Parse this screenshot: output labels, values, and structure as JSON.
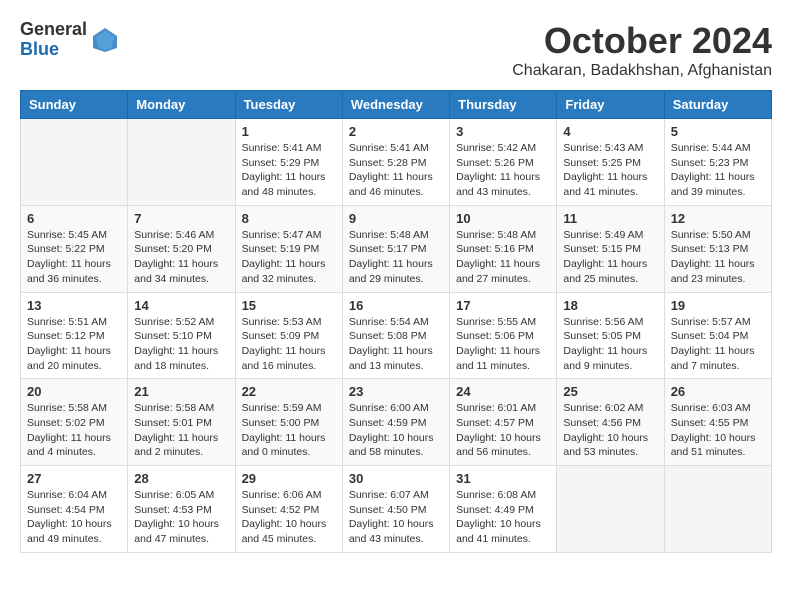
{
  "logo": {
    "general": "General",
    "blue": "Blue"
  },
  "title": "October 2024",
  "location": "Chakaran, Badakhshan, Afghanistan",
  "days_header": [
    "Sunday",
    "Monday",
    "Tuesday",
    "Wednesday",
    "Thursday",
    "Friday",
    "Saturday"
  ],
  "weeks": [
    [
      {
        "day": "",
        "sunrise": "",
        "sunset": "",
        "daylight": ""
      },
      {
        "day": "",
        "sunrise": "",
        "sunset": "",
        "daylight": ""
      },
      {
        "day": "1",
        "sunrise": "Sunrise: 5:41 AM",
        "sunset": "Sunset: 5:29 PM",
        "daylight": "Daylight: 11 hours and 48 minutes."
      },
      {
        "day": "2",
        "sunrise": "Sunrise: 5:41 AM",
        "sunset": "Sunset: 5:28 PM",
        "daylight": "Daylight: 11 hours and 46 minutes."
      },
      {
        "day": "3",
        "sunrise": "Sunrise: 5:42 AM",
        "sunset": "Sunset: 5:26 PM",
        "daylight": "Daylight: 11 hours and 43 minutes."
      },
      {
        "day": "4",
        "sunrise": "Sunrise: 5:43 AM",
        "sunset": "Sunset: 5:25 PM",
        "daylight": "Daylight: 11 hours and 41 minutes."
      },
      {
        "day": "5",
        "sunrise": "Sunrise: 5:44 AM",
        "sunset": "Sunset: 5:23 PM",
        "daylight": "Daylight: 11 hours and 39 minutes."
      }
    ],
    [
      {
        "day": "6",
        "sunrise": "Sunrise: 5:45 AM",
        "sunset": "Sunset: 5:22 PM",
        "daylight": "Daylight: 11 hours and 36 minutes."
      },
      {
        "day": "7",
        "sunrise": "Sunrise: 5:46 AM",
        "sunset": "Sunset: 5:20 PM",
        "daylight": "Daylight: 11 hours and 34 minutes."
      },
      {
        "day": "8",
        "sunrise": "Sunrise: 5:47 AM",
        "sunset": "Sunset: 5:19 PM",
        "daylight": "Daylight: 11 hours and 32 minutes."
      },
      {
        "day": "9",
        "sunrise": "Sunrise: 5:48 AM",
        "sunset": "Sunset: 5:17 PM",
        "daylight": "Daylight: 11 hours and 29 minutes."
      },
      {
        "day": "10",
        "sunrise": "Sunrise: 5:48 AM",
        "sunset": "Sunset: 5:16 PM",
        "daylight": "Daylight: 11 hours and 27 minutes."
      },
      {
        "day": "11",
        "sunrise": "Sunrise: 5:49 AM",
        "sunset": "Sunset: 5:15 PM",
        "daylight": "Daylight: 11 hours and 25 minutes."
      },
      {
        "day": "12",
        "sunrise": "Sunrise: 5:50 AM",
        "sunset": "Sunset: 5:13 PM",
        "daylight": "Daylight: 11 hours and 23 minutes."
      }
    ],
    [
      {
        "day": "13",
        "sunrise": "Sunrise: 5:51 AM",
        "sunset": "Sunset: 5:12 PM",
        "daylight": "Daylight: 11 hours and 20 minutes."
      },
      {
        "day": "14",
        "sunrise": "Sunrise: 5:52 AM",
        "sunset": "Sunset: 5:10 PM",
        "daylight": "Daylight: 11 hours and 18 minutes."
      },
      {
        "day": "15",
        "sunrise": "Sunrise: 5:53 AM",
        "sunset": "Sunset: 5:09 PM",
        "daylight": "Daylight: 11 hours and 16 minutes."
      },
      {
        "day": "16",
        "sunrise": "Sunrise: 5:54 AM",
        "sunset": "Sunset: 5:08 PM",
        "daylight": "Daylight: 11 hours and 13 minutes."
      },
      {
        "day": "17",
        "sunrise": "Sunrise: 5:55 AM",
        "sunset": "Sunset: 5:06 PM",
        "daylight": "Daylight: 11 hours and 11 minutes."
      },
      {
        "day": "18",
        "sunrise": "Sunrise: 5:56 AM",
        "sunset": "Sunset: 5:05 PM",
        "daylight": "Daylight: 11 hours and 9 minutes."
      },
      {
        "day": "19",
        "sunrise": "Sunrise: 5:57 AM",
        "sunset": "Sunset: 5:04 PM",
        "daylight": "Daylight: 11 hours and 7 minutes."
      }
    ],
    [
      {
        "day": "20",
        "sunrise": "Sunrise: 5:58 AM",
        "sunset": "Sunset: 5:02 PM",
        "daylight": "Daylight: 11 hours and 4 minutes."
      },
      {
        "day": "21",
        "sunrise": "Sunrise: 5:58 AM",
        "sunset": "Sunset: 5:01 PM",
        "daylight": "Daylight: 11 hours and 2 minutes."
      },
      {
        "day": "22",
        "sunrise": "Sunrise: 5:59 AM",
        "sunset": "Sunset: 5:00 PM",
        "daylight": "Daylight: 11 hours and 0 minutes."
      },
      {
        "day": "23",
        "sunrise": "Sunrise: 6:00 AM",
        "sunset": "Sunset: 4:59 PM",
        "daylight": "Daylight: 10 hours and 58 minutes."
      },
      {
        "day": "24",
        "sunrise": "Sunrise: 6:01 AM",
        "sunset": "Sunset: 4:57 PM",
        "daylight": "Daylight: 10 hours and 56 minutes."
      },
      {
        "day": "25",
        "sunrise": "Sunrise: 6:02 AM",
        "sunset": "Sunset: 4:56 PM",
        "daylight": "Daylight: 10 hours and 53 minutes."
      },
      {
        "day": "26",
        "sunrise": "Sunrise: 6:03 AM",
        "sunset": "Sunset: 4:55 PM",
        "daylight": "Daylight: 10 hours and 51 minutes."
      }
    ],
    [
      {
        "day": "27",
        "sunrise": "Sunrise: 6:04 AM",
        "sunset": "Sunset: 4:54 PM",
        "daylight": "Daylight: 10 hours and 49 minutes."
      },
      {
        "day": "28",
        "sunrise": "Sunrise: 6:05 AM",
        "sunset": "Sunset: 4:53 PM",
        "daylight": "Daylight: 10 hours and 47 minutes."
      },
      {
        "day": "29",
        "sunrise": "Sunrise: 6:06 AM",
        "sunset": "Sunset: 4:52 PM",
        "daylight": "Daylight: 10 hours and 45 minutes."
      },
      {
        "day": "30",
        "sunrise": "Sunrise: 6:07 AM",
        "sunset": "Sunset: 4:50 PM",
        "daylight": "Daylight: 10 hours and 43 minutes."
      },
      {
        "day": "31",
        "sunrise": "Sunrise: 6:08 AM",
        "sunset": "Sunset: 4:49 PM",
        "daylight": "Daylight: 10 hours and 41 minutes."
      },
      {
        "day": "",
        "sunrise": "",
        "sunset": "",
        "daylight": ""
      },
      {
        "day": "",
        "sunrise": "",
        "sunset": "",
        "daylight": ""
      }
    ]
  ]
}
